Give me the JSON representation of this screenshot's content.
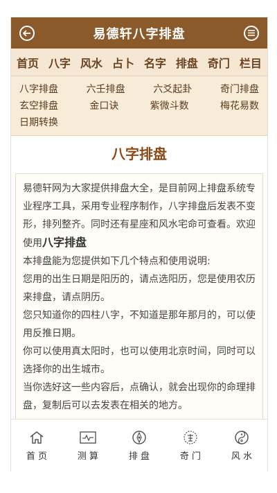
{
  "header": {
    "title": "易德轩八字排盘",
    "back_icon": "back-arrow-icon",
    "menu_icon": "menu-icon"
  },
  "nav": [
    "首页",
    "八字",
    "风水",
    "占卜",
    "名字",
    "排盘",
    "奇门",
    "栏目"
  ],
  "subnav": {
    "row1": [
      "八字排盘",
      "六壬排盘",
      "六爻起卦",
      "奇门排盘"
    ],
    "row2": [
      "玄空排盘",
      "金口诀",
      "紫微斗数",
      "梅花易数"
    ],
    "row3": [
      "日期转换"
    ]
  },
  "section": {
    "title": "八字排盘"
  },
  "content": {
    "intro": "易德轩网为大家提供排盘大全，是目前网上排盘系统专业程序工具，采用专业程序制作，八字排盘后发表不变形，排列整齐。同时还有星座和风水宅命可查看。欢迎使用",
    "intro_strong": "八字排盘",
    "p1": "本排盘能为您提供如下几个特点和使用说明:",
    "p2": "您用的出生日期是阳历的，请点选阳历，您是使用农历来排盘，请点阴历。",
    "p3": "您只知道你的四柱八字，不知道是那年那月的，可以使用反推日期。",
    "p4": "你可以使用真太阳时，也可以使用北京时间，同时可以选择你的出生城市。",
    "p5": "当你选好这一些内容后，点确认，就会出现你的命理排盘，复制后可以去发表在相关的地方。"
  },
  "bottom_nav": [
    {
      "label": "首 页",
      "icon": "home-icon"
    },
    {
      "label": "测 算",
      "icon": "pulse-chart-icon"
    },
    {
      "label": "排 盘",
      "icon": "compass-icon"
    },
    {
      "label": "奇 门",
      "icon": "qimen-seal-icon"
    },
    {
      "label": "风 水",
      "icon": "yin-yang-icon"
    }
  ],
  "colors": {
    "brand": "#8b5a2b",
    "nav_bg": "#f5e7d4",
    "accent_text": "#8b4a17"
  }
}
